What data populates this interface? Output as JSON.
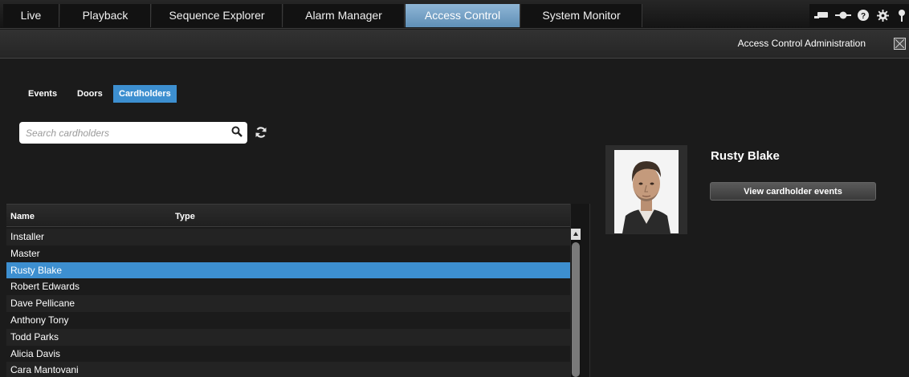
{
  "tabs": [
    {
      "label": "Live"
    },
    {
      "label": "Playback"
    },
    {
      "label": "Sequence Explorer"
    },
    {
      "label": "Alarm Manager"
    },
    {
      "label": "Access Control"
    },
    {
      "label": "System Monitor"
    }
  ],
  "active_tab": "Access Control",
  "top_icons": [
    "screen-icon",
    "pin-icon",
    "help-icon",
    "gear-icon",
    "alert-icon"
  ],
  "header": {
    "title": "Access Control Administration"
  },
  "subtabs": [
    {
      "label": "Events"
    },
    {
      "label": "Doors"
    },
    {
      "label": "Cardholders"
    }
  ],
  "active_subtab": "Cardholders",
  "search": {
    "placeholder": "Search cardholders",
    "value": ""
  },
  "table": {
    "columns": [
      "Name",
      "Type"
    ],
    "rows": [
      {
        "name": "Installer",
        "type": ""
      },
      {
        "name": "Master",
        "type": ""
      },
      {
        "name": "Rusty Blake",
        "type": ""
      },
      {
        "name": "Robert Edwards",
        "type": ""
      },
      {
        "name": "Dave Pellicane",
        "type": ""
      },
      {
        "name": "Anthony Tony",
        "type": ""
      },
      {
        "name": "Todd Parks",
        "type": ""
      },
      {
        "name": "Alicia Davis",
        "type": ""
      },
      {
        "name": "Cara Mantovani",
        "type": ""
      }
    ],
    "selected_row": "Rusty Blake"
  },
  "detail": {
    "name": "Rusty Blake",
    "button_label": "View cardholder events"
  },
  "colors": {
    "accent": "#3d8fd0",
    "active_tab": "#6f9dc4",
    "background": "#1b1b1b"
  }
}
